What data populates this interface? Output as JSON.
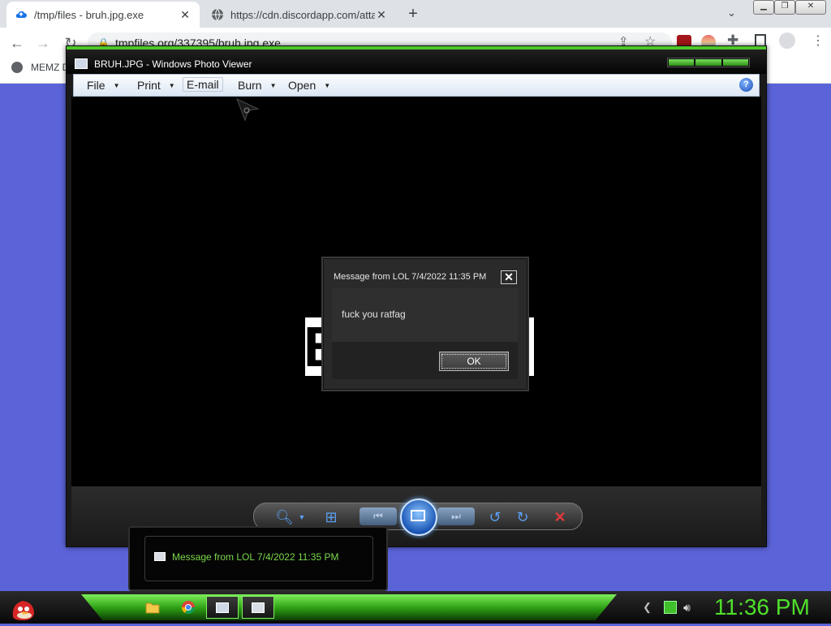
{
  "browser": {
    "tabs": [
      {
        "label": "/tmp/files - bruh.jpg.exe",
        "icon": "cloud-upload-icon",
        "active": true
      },
      {
        "label": "https://cdn.discordapp.com/attac",
        "icon": "globe-icon",
        "active": false
      }
    ],
    "new_tab": "+",
    "url": "tmpfiles.org/337395/bruh.jpg.exe",
    "bookmark": "MEMZ D",
    "window_buttons": [
      "minimize",
      "restore",
      "close"
    ]
  },
  "viewer": {
    "title": "BRUH.JPG - Windows Photo Viewer",
    "menu": [
      {
        "label": "File",
        "has_arrow": true
      },
      {
        "label": "Print",
        "has_arrow": true
      },
      {
        "label": "E-mail",
        "has_arrow": false
      },
      {
        "label": "Burn",
        "has_arrow": true
      },
      {
        "label": "Open",
        "has_arrow": true
      }
    ],
    "help": "?",
    "image_text": "B"
  },
  "dialog": {
    "title": "Message from LOL 7/4/2022 11:35 PM",
    "message": "fuck you ratfag",
    "ok": "OK"
  },
  "taskbar": {
    "popup_label": "Message from LOL 7/4/2022 11:35 PM",
    "clock": "11:36 PM",
    "accent": "#4fe02b"
  }
}
